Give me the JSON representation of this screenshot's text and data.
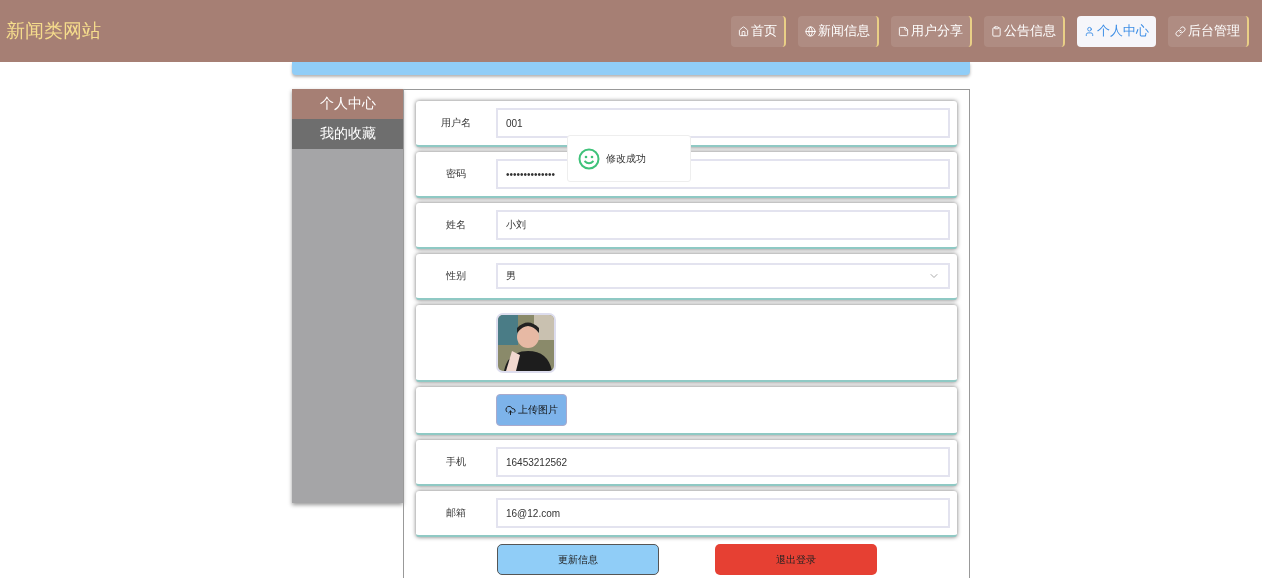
{
  "header": {
    "title": "新闻类网站",
    "nav": [
      {
        "label": "首页",
        "selected": false
      },
      {
        "label": "新闻信息",
        "selected": false
      },
      {
        "label": "用户分享",
        "selected": false
      },
      {
        "label": "公告信息",
        "selected": false
      },
      {
        "label": "个人中心",
        "selected": true
      },
      {
        "label": "后台管理",
        "selected": false
      }
    ]
  },
  "sidebar": {
    "items": [
      {
        "label": "个人中心",
        "selected": true
      },
      {
        "label": "我的收藏",
        "selected": false
      }
    ]
  },
  "form": {
    "rows": [
      {
        "kind": "text",
        "label": "用户名",
        "value": "001"
      },
      {
        "kind": "text",
        "label": "密码",
        "value": "••••••••••••••"
      },
      {
        "kind": "text",
        "label": "姓名",
        "value": "小刘"
      },
      {
        "kind": "select",
        "label": "性别",
        "value": "男"
      },
      {
        "kind": "avatar"
      },
      {
        "kind": "upload",
        "button": "上传图片"
      },
      {
        "kind": "text",
        "label": "手机",
        "value": "16453212562"
      },
      {
        "kind": "text",
        "label": "邮箱",
        "value": "16@12.com"
      }
    ],
    "buttons": [
      {
        "label": "更新信息",
        "kind": "primary"
      },
      {
        "label": "退出登录",
        "kind": "danger"
      }
    ]
  },
  "toast": {
    "message": "修改成功"
  }
}
